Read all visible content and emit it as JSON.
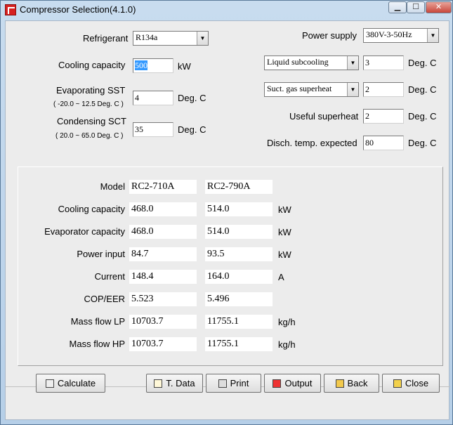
{
  "window": {
    "title": "Compressor Selection(4.1.0)",
    "min": "0",
    "max": "1",
    "close": "r"
  },
  "inputs": {
    "refrigerant": {
      "label": "Refrigerant",
      "value": "R134a"
    },
    "cooling_capacity": {
      "label": "Cooling capacity",
      "value": "500",
      "unit": "kW"
    },
    "evap_sst": {
      "label": "Evaporating SST",
      "range": "( -20.0 ~ 12.5 Deg. C )",
      "value": "4",
      "unit": "Deg. C"
    },
    "cond_sct": {
      "label": "Condensing SCT",
      "range": "( 20.0 ~ 65.0 Deg. C )",
      "value": "35",
      "unit": "Deg. C"
    },
    "power_supply": {
      "label": "Power supply",
      "value": "380V-3-50Hz"
    },
    "liquid_subcooling": {
      "value": "Liquid subcooling",
      "field": "3",
      "unit": "Deg. C"
    },
    "suct_gas_superheat": {
      "value": "Suct. gas superheat",
      "field": "2",
      "unit": "Deg. C"
    },
    "useful_superheat": {
      "label": "Useful superheat",
      "value": "2",
      "unit": "Deg. C"
    },
    "disch_temp": {
      "label": "Disch. temp. expected",
      "value": "80",
      "unit": "Deg. C"
    }
  },
  "results": {
    "rows": [
      {
        "label": "Model",
        "a": "RC2-710A",
        "b": "RC2-790A",
        "unit": ""
      },
      {
        "label": "Cooling capacity",
        "a": "468.0",
        "b": "514.0",
        "unit": "kW"
      },
      {
        "label": "Evaporator capacity",
        "a": "468.0",
        "b": "514.0",
        "unit": "kW"
      },
      {
        "label": "Power input",
        "a": "84.7",
        "b": "93.5",
        "unit": "kW"
      },
      {
        "label": "Current",
        "a": "148.4",
        "b": "164.0",
        "unit": "A"
      },
      {
        "label": "COP/EER",
        "a": "5.523",
        "b": "5.496",
        "unit": ""
      },
      {
        "label": "Mass flow LP",
        "a": "10703.7",
        "b": "11755.1",
        "unit": "kg/h"
      },
      {
        "label": "Mass flow HP",
        "a": "10703.7",
        "b": "11755.1",
        "unit": "kg/h"
      }
    ]
  },
  "buttons": {
    "calculate": "Calculate",
    "tdata": "T. Data",
    "print": "Print",
    "output": "Output",
    "back": "Back",
    "close": "Close"
  },
  "colors": {
    "selection": "#3399ff",
    "close_button": "#c9463a"
  },
  "icons": [
    "app-icon",
    "calculator-icon",
    "document-icon",
    "printer-icon",
    "output-icon",
    "back-icon",
    "exit-icon"
  ]
}
